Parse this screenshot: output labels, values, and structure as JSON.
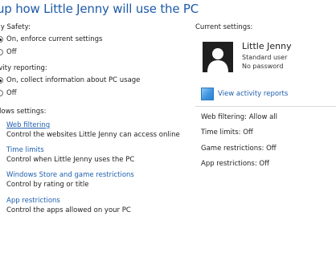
{
  "header": {
    "title": "up how Little Jenny will use the PC"
  },
  "family_safety": {
    "label": "ily Safety:",
    "options": [
      {
        "label": "On, enforce current settings",
        "selected": true
      },
      {
        "label": "Off",
        "selected": false
      }
    ]
  },
  "activity_reporting": {
    "label": "ivity reporting:",
    "options": [
      {
        "label": "On, collect information about PC usage",
        "selected": true
      },
      {
        "label": "Off",
        "selected": false
      }
    ]
  },
  "windows_settings": {
    "label": "dows settings:",
    "items": [
      {
        "title": "Web filtering",
        "description": "Control the websites Little Jenny can access online"
      },
      {
        "title": "Time limits",
        "description": "Control when Little Jenny uses the PC"
      },
      {
        "title": "Windows Store and game restrictions",
        "description": "Control by rating or title"
      },
      {
        "title": "App restrictions",
        "description": "Control the apps allowed on your PC"
      }
    ]
  },
  "current_settings": {
    "label": "Current settings:",
    "user": {
      "name": "Little Jenny",
      "account_type": "Standard user",
      "password_status": "No password"
    },
    "view_reports_label": "View activity reports",
    "settings": [
      "Web filtering: Allow all",
      "Time limits: Off",
      "Game restrictions: Off",
      "App restrictions: Off"
    ]
  },
  "colors": {
    "title": "#1e5aa8",
    "link": "#1f5fae",
    "avatar_bg": "#1f1f1f"
  },
  "icons": {
    "avatar": "user-silhouette-icon",
    "reports": "activity-report-icon"
  }
}
